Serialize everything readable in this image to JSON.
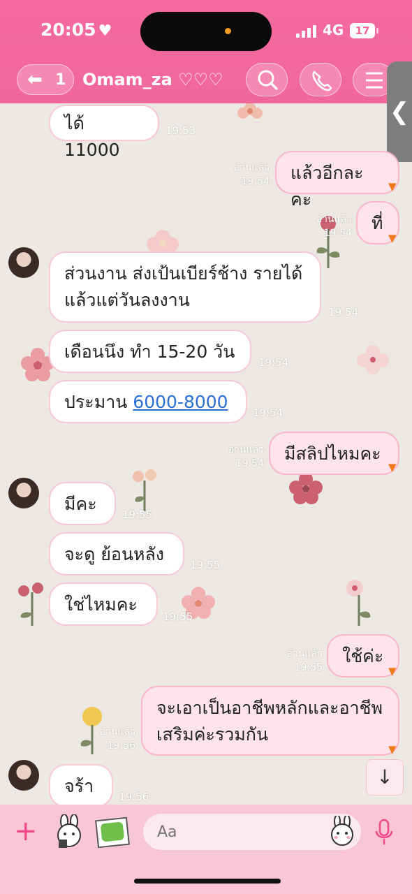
{
  "status_bar": {
    "time": "20:05",
    "network": "4G",
    "battery": "17"
  },
  "header": {
    "back_count": "1",
    "title": "Omam_za ♡♡♡"
  },
  "input": {
    "placeholder": "Aa"
  },
  "messages": [
    {
      "side": "in",
      "text": "ได้ 11000",
      "time": "19:53"
    },
    {
      "side": "out",
      "text": "แล้วอีกละคะ",
      "read": "อ่านแล้ว",
      "time": "19:54"
    },
    {
      "side": "out",
      "text": "ที่",
      "read": "อ่านแล้ว",
      "time": "19:54"
    },
    {
      "side": "in",
      "text_line1": "ส่วนงาน ส่งเป้นเบียร์ช้าง รายได้",
      "text_line2": "แล้วแต่วันลงงาน",
      "time": "19:54"
    },
    {
      "side": "in",
      "text": "เดือนนึง ทำ 15-20 วัน",
      "time": "19:54"
    },
    {
      "side": "in",
      "prefix": "ประมาน",
      "link": "6000-8000",
      "time": "19:54"
    },
    {
      "side": "out",
      "text": "มีสลิปไหมคะ",
      "read": "อ่านแล้ว",
      "time": "19:54"
    },
    {
      "side": "in",
      "text": "มีคะ",
      "time": "19:55"
    },
    {
      "side": "in",
      "text": "จะดู ย้อนหลัง",
      "time": "19:55"
    },
    {
      "side": "in",
      "text": "ใช่ไหมคะ",
      "time": "19:55"
    },
    {
      "side": "out",
      "text": "ใช้ค่ะ",
      "read": "อ่านแล้ว",
      "time": "19:55"
    },
    {
      "side": "out",
      "text_line1": "จะเอาเป็นอาชีพหลักและอาชีพ",
      "text_line2": "เสริมค่ะรวมกัน",
      "read": "อ่านแล้ว",
      "time": "19:56"
    },
    {
      "side": "in",
      "text": "จร้า",
      "time": "19:56"
    }
  ],
  "icons": {
    "heart": "heart-icon",
    "back": "back-arrow-icon",
    "search": "search-icon",
    "call": "phone-icon",
    "menu": "menu-icon",
    "plus": "plus-icon",
    "sticker": "sticker-icon",
    "photo": "photo-icon",
    "emoji": "emoji-icon",
    "mic": "microphone-icon",
    "scroll_down": "arrow-down-icon",
    "side_tab": "chevron-left-icon"
  },
  "colors": {
    "header": "#f0679c",
    "accent": "#f04a8a",
    "bubble_out": "#fde4ec",
    "link": "#2a6fd6"
  }
}
